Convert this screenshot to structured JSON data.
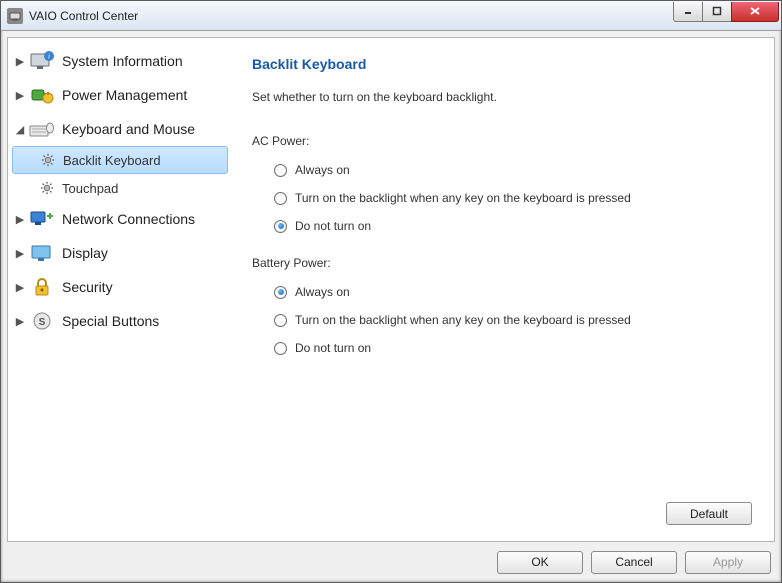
{
  "window": {
    "title": "VAIO Control Center"
  },
  "nav": {
    "items": [
      {
        "label": "System Information",
        "expanded": false
      },
      {
        "label": "Power Management",
        "expanded": false
      },
      {
        "label": "Keyboard and Mouse",
        "expanded": true,
        "children": [
          {
            "label": "Backlit Keyboard",
            "selected": true
          },
          {
            "label": "Touchpad",
            "selected": false
          }
        ]
      },
      {
        "label": "Network Connections",
        "expanded": false
      },
      {
        "label": "Display",
        "expanded": false
      },
      {
        "label": "Security",
        "expanded": false
      },
      {
        "label": "Special Buttons",
        "expanded": false
      }
    ]
  },
  "content": {
    "heading": "Backlit Keyboard",
    "description": "Set whether to turn on the keyboard backlight.",
    "groups": [
      {
        "label": "AC Power:",
        "options": [
          {
            "label": "Always on",
            "checked": false
          },
          {
            "label": "Turn on the backlight when any key on the keyboard is pressed",
            "checked": false
          },
          {
            "label": "Do not turn on",
            "checked": true
          }
        ]
      },
      {
        "label": "Battery Power:",
        "options": [
          {
            "label": "Always on",
            "checked": true
          },
          {
            "label": "Turn on the backlight when any key on the keyboard is pressed",
            "checked": false
          },
          {
            "label": "Do not turn on",
            "checked": false
          }
        ]
      }
    ],
    "default_button": "Default"
  },
  "footer": {
    "ok": "OK",
    "cancel": "Cancel",
    "apply": "Apply"
  }
}
